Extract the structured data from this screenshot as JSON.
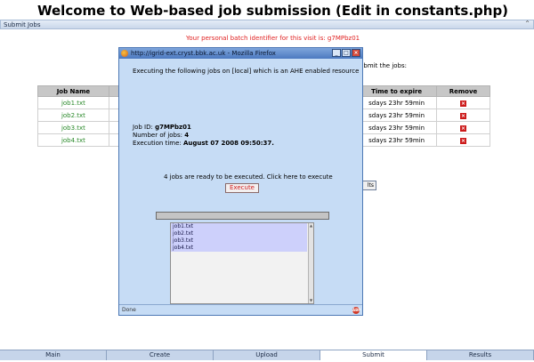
{
  "page": {
    "title": "Welcome to Web-based job submission (Edit in constants.php)",
    "section_title": "Submit Jobs",
    "batch_line": "Your personal batch identifier for this visit is: g7MPbz01",
    "submit_hint": "ubmit the jobs:",
    "results_label": "lts"
  },
  "table": {
    "headers": {
      "name": "Job Name",
      "expire": "Time to expire",
      "remove": "Remove"
    },
    "rows": [
      {
        "name": "job1.txt",
        "expire": "sdays 23hr 59min",
        "remove": "×"
      },
      {
        "name": "job2.txt",
        "expire": "sdays 23hr 59min",
        "remove": "×"
      },
      {
        "name": "job3.txt",
        "expire": "sdays 23hr 59min",
        "remove": "×"
      },
      {
        "name": "job4.txt",
        "expire": "sdays 23hr 59min",
        "remove": "×"
      }
    ]
  },
  "popup": {
    "title": "http://igrid-ext.cryst.bbk.ac.uk - Mozilla Firefox",
    "minimize": "_",
    "maximize": "□",
    "close": "×",
    "heading": "Executing the following jobs on [local] which is an AHE enabled resource",
    "job_id_label": "Job ID: ",
    "job_id_value": "g7MPbz01",
    "num_jobs_label": "Number of jobs: ",
    "num_jobs_value": "4",
    "exec_time_label": "Execution time: ",
    "exec_time_value": "August 07 2008 09:50:37.",
    "ready_text": "4 jobs are ready to be executed. Click here to execute",
    "execute_label": "Execute",
    "list_items": [
      "job1.txt",
      "job2.txt",
      "job3.txt",
      "job4.txt"
    ],
    "status": "Done",
    "status_icon": "ABP"
  },
  "tabs": [
    {
      "label": "Main"
    },
    {
      "label": "Create"
    },
    {
      "label": "Upload"
    },
    {
      "label": "Submit"
    },
    {
      "label": "Results"
    }
  ],
  "colors": {
    "accent_red": "#e02020",
    "job_green": "#2b8a2b",
    "popup_bg": "#c6dcf5",
    "list_highlight": "#cdd0fb"
  },
  "icons": {
    "window_icon": "firefox-icon",
    "remove_icon": "remove-x-icon",
    "status_icon": "adblock-icon"
  }
}
